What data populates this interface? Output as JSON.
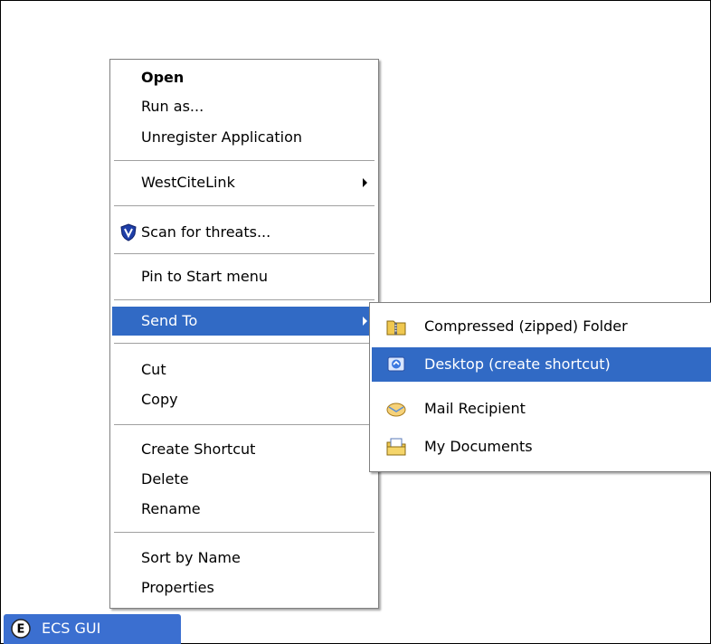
{
  "context_menu": {
    "items": [
      {
        "label": "Open"
      },
      {
        "label": "Run as..."
      },
      {
        "label": "Unregister Application"
      },
      {
        "label": "WestCiteLink"
      },
      {
        "label": "Scan for threats..."
      },
      {
        "label": "Pin to Start menu"
      },
      {
        "label": "Send To"
      },
      {
        "label": "Cut"
      },
      {
        "label": "Copy"
      },
      {
        "label": "Create Shortcut"
      },
      {
        "label": "Delete"
      },
      {
        "label": "Rename"
      },
      {
        "label": "Sort by Name"
      },
      {
        "label": "Properties"
      }
    ],
    "highlight_color": "#316ac5"
  },
  "send_to_menu": {
    "items": [
      {
        "label": "Compressed (zipped) Folder",
        "icon": "zip-folder-icon"
      },
      {
        "label": "Desktop (create shortcut)",
        "icon": "desktop-icon"
      },
      {
        "label": "Mail Recipient",
        "icon": "mail-icon"
      },
      {
        "label": "My Documents",
        "icon": "my-documents-icon"
      }
    ]
  },
  "taskbar": {
    "button_label": "ECS GUI",
    "color": "#3b6fd0"
  }
}
